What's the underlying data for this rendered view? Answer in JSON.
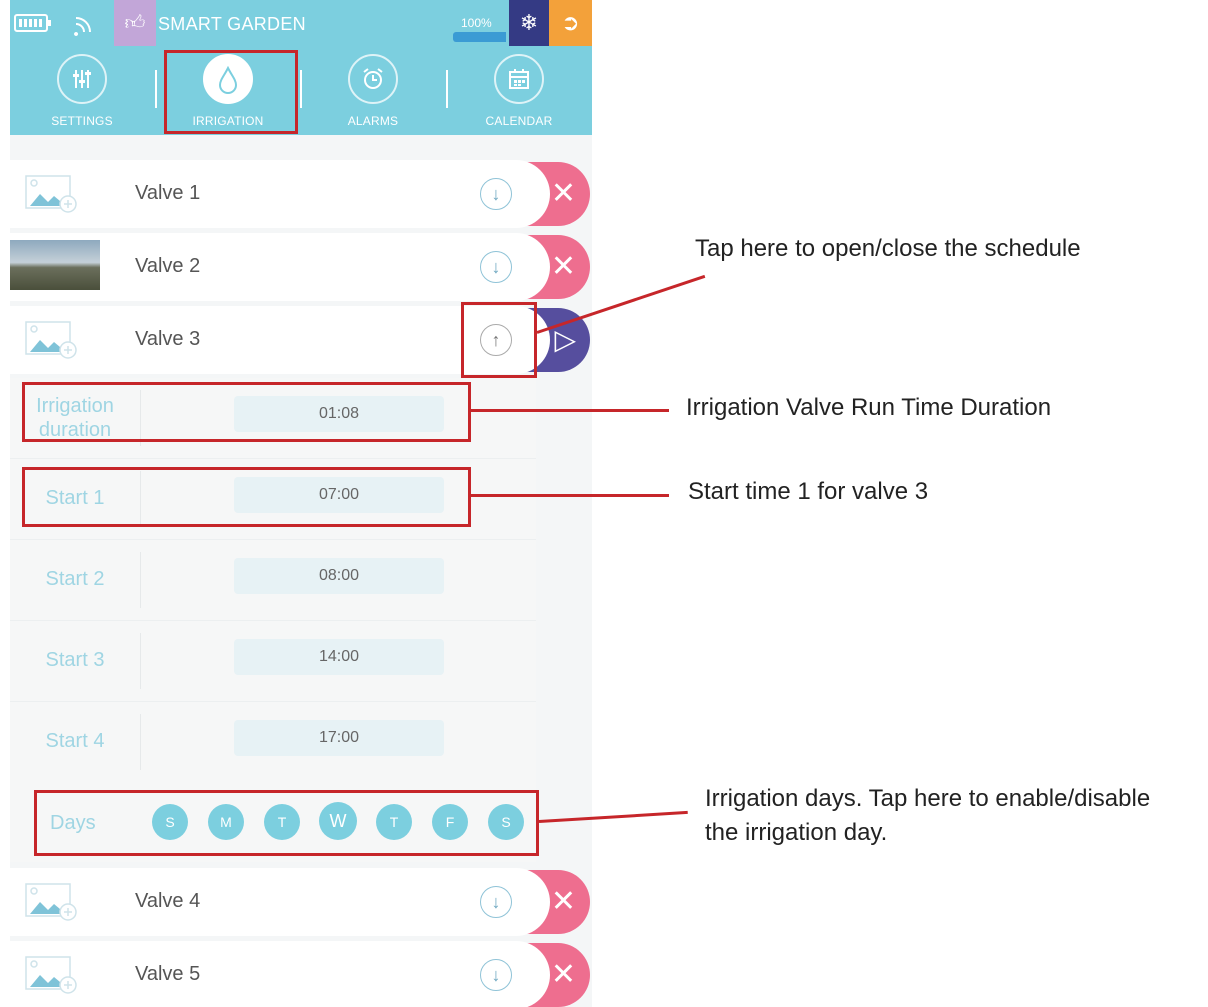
{
  "status_bar": {
    "app_title": "SMART GARDEN",
    "progress_label": "100%",
    "progress_value": 0.95,
    "icons": [
      "battery-icon",
      "wifi-icon",
      "thumbs-up-icon",
      "snowflake-icon",
      "exit-icon"
    ]
  },
  "tabs": [
    {
      "label": "SETTINGS",
      "icon": "sliders-icon",
      "active": false
    },
    {
      "label": "IRRIGATION",
      "icon": "water-drop-icon",
      "active": true
    },
    {
      "label": "ALARMS",
      "icon": "alarm-clock-icon",
      "active": false
    },
    {
      "label": "CALENDAR",
      "icon": "calendar-icon",
      "active": false
    }
  ],
  "valves": [
    {
      "name": "Valve 1",
      "toggle": "down-arrow-icon",
      "action": "delete-icon",
      "action_color": "#ee6e8f"
    },
    {
      "name": "Valve 2",
      "toggle": "down-arrow-icon",
      "action": "delete-icon",
      "action_color": "#ee6e8f"
    },
    {
      "name": "Valve 3",
      "toggle": "up-arrow-icon",
      "action": "play-icon",
      "action_color": "#564e9e"
    },
    {
      "name": "Valve 4",
      "toggle": "down-arrow-icon",
      "action": "delete-icon",
      "action_color": "#ee6e8f"
    },
    {
      "name": "Valve 5",
      "toggle": "down-arrow-icon",
      "action": "delete-icon",
      "action_color": "#ee6e8f"
    }
  ],
  "schedule": [
    {
      "label": "Irrigation duration",
      "value": "01:08"
    },
    {
      "label": "Start 1",
      "value": "07:00"
    },
    {
      "label": "Start 2",
      "value": "08:00"
    },
    {
      "label": "Start 3",
      "value": "14:00"
    },
    {
      "label": "Start 4",
      "value": "17:00"
    }
  ],
  "days": {
    "label": "Days",
    "items": [
      "S",
      "M",
      "T",
      "W",
      "T",
      "F",
      "S"
    ]
  },
  "annotations": {
    "toggle": "Tap here to open/close the schedule",
    "duration": "Irrigation Valve Run Time Duration",
    "start1": "Start time 1 for valve 3",
    "days_line1": "Irrigation days. Tap here to enable/disable",
    "days_line2": "the irrigation day."
  },
  "colors": {
    "header": "#7ccfdf",
    "highlight": "#c6262a",
    "delete": "#ee6e8f",
    "play": "#564e9e"
  }
}
